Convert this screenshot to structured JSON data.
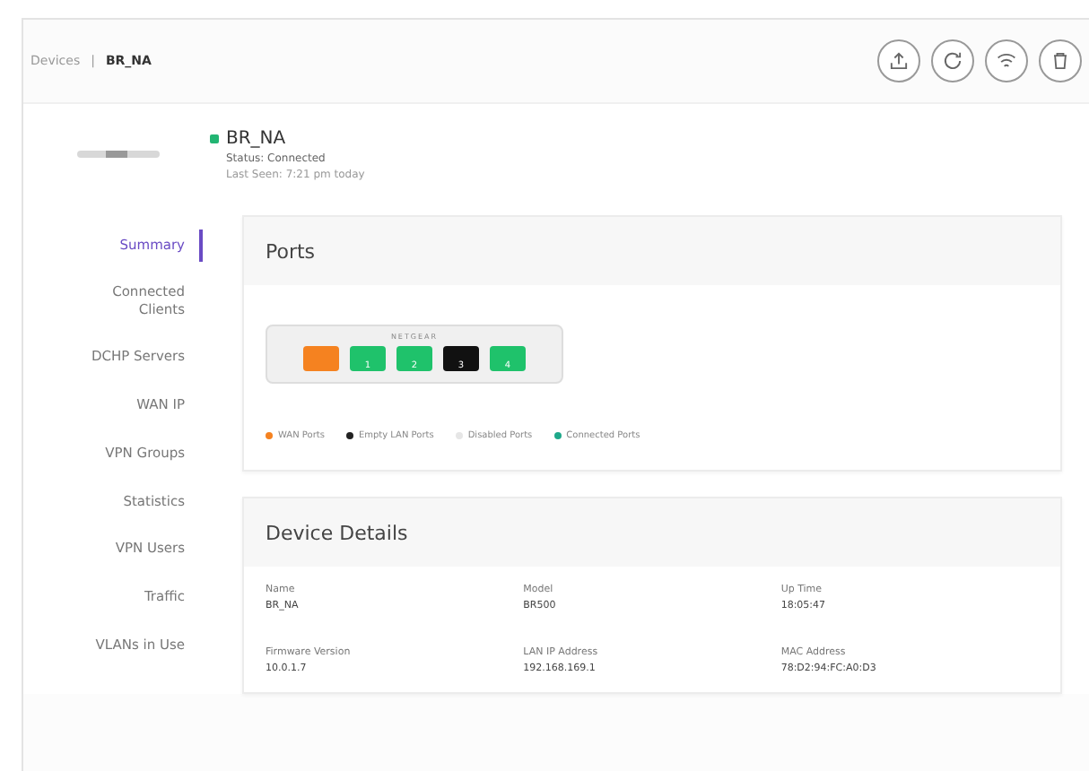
{
  "breadcrumb": {
    "parent": "Devices",
    "separator": "|",
    "current": "BR_NA"
  },
  "header_actions": [
    {
      "kind": "upload"
    },
    {
      "kind": "refresh"
    },
    {
      "kind": "wifi"
    },
    {
      "kind": "delete"
    }
  ],
  "device": {
    "name": "BR_NA",
    "color": "#22b573",
    "status": "Status: Connected",
    "last_seen": "Last Seen: 7:21 pm today"
  },
  "sidebar": {
    "items": [
      {
        "label": "Summary",
        "selected": true
      },
      {
        "label": "Connected Clients",
        "selected": false
      },
      {
        "label": "DCHP Servers",
        "selected": false
      },
      {
        "label": "WAN IP",
        "selected": false
      },
      {
        "label": "VPN Groups",
        "selected": false
      },
      {
        "label": "Statistics",
        "selected": false
      },
      {
        "label": "VPN Users",
        "selected": false
      },
      {
        "label": "Traffic",
        "selected": false
      },
      {
        "label": "VLANs in Use",
        "selected": false
      }
    ]
  },
  "ports": {
    "title": "Ports",
    "brand": "NETGEAR",
    "ports": [
      {
        "color": "#f58220"
      },
      {
        "label": "1",
        "color": "#1fc26b"
      },
      {
        "label": "2",
        "color": "#1fc26b"
      },
      {
        "label": "3",
        "color": "#111111"
      },
      {
        "label": "4",
        "color": "#1fc26b"
      }
    ],
    "legend": [
      {
        "label": "WAN Ports",
        "color": "#f58220"
      },
      {
        "label": "Empty LAN Ports",
        "color": "#222222"
      },
      {
        "label": "Disabled Ports",
        "color": "#e6e6e6"
      },
      {
        "label": "Connected Ports",
        "color": "#1fa88a"
      }
    ]
  },
  "device_details": {
    "title": "Device Details",
    "fields": [
      {
        "label": "Name",
        "value": "BR_NA"
      },
      {
        "label": "Model",
        "value": "BR500"
      },
      {
        "label": "Up Time",
        "value": "18:05:47"
      },
      {
        "label": "Firmware Version",
        "value": "10.0.1.7"
      },
      {
        "label": "LAN IP Address",
        "value": "192.168.169.1"
      },
      {
        "label": "MAC Address",
        "value": "78:D2:94:FC:A0:D3"
      }
    ]
  }
}
